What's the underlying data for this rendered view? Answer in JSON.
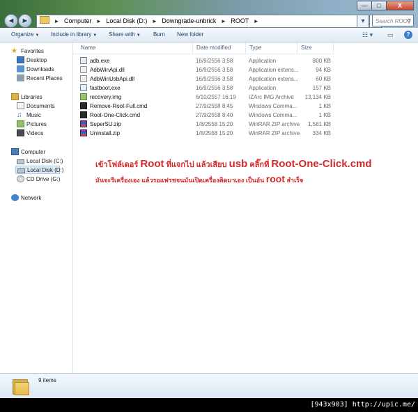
{
  "window": {
    "buttons": {
      "minimize": "—",
      "maximize": "□",
      "close": "X"
    }
  },
  "nav": {
    "back": "◄",
    "forward": "►",
    "breadcrumb": [
      "Computer",
      "Local Disk (D:)",
      "Downgrade-unbrick",
      "ROOT"
    ],
    "search_placeholder": "Search ROOT"
  },
  "toolbar": {
    "organize": "Organize",
    "include_in_library": "Include in library",
    "share_with": "Share with",
    "burn": "Burn",
    "new_folder": "New folder"
  },
  "sidebar": {
    "favorites_header": "Favorites",
    "favorites": [
      {
        "label": "Desktop",
        "icon": "desktop-icon"
      },
      {
        "label": "Downloads",
        "icon": "downloads-icon"
      },
      {
        "label": "Recent Places",
        "icon": "recent-places-icon"
      }
    ],
    "libraries_header": "Libraries",
    "libraries": [
      {
        "label": "Documents",
        "icon": "documents-icon"
      },
      {
        "label": "Music",
        "icon": "music-icon"
      },
      {
        "label": "Pictures",
        "icon": "pictures-icon"
      },
      {
        "label": "Videos",
        "icon": "videos-icon"
      }
    ],
    "computer_header": "Computer",
    "drives": [
      {
        "label": "Local Disk (C:)",
        "icon": "disk-icon"
      },
      {
        "label": "Local Disk (D:)",
        "icon": "disk-icon",
        "selected": true
      },
      {
        "label": "CD Drive (G:)",
        "icon": "cd-drive-icon"
      }
    ],
    "network_header": "Network"
  },
  "columns": {
    "name": "Name",
    "date": "Date modified",
    "type": "Type",
    "size": "Size"
  },
  "files": [
    {
      "name": "adb.exe",
      "date": "16/9/2556 3:58",
      "type": "Application",
      "size": "800 KB",
      "icon": "app"
    },
    {
      "name": "AdbWinApi.dll",
      "date": "16/9/2556 3:58",
      "type": "Application extens...",
      "size": "94 KB",
      "icon": "dll"
    },
    {
      "name": "AdbWinUsbApi.dll",
      "date": "16/9/2556 3:58",
      "type": "Application extens...",
      "size": "60 KB",
      "icon": "dll"
    },
    {
      "name": "fastboot.exe",
      "date": "16/9/2556 3:58",
      "type": "Application",
      "size": "157 KB",
      "icon": "app"
    },
    {
      "name": "recovery.img",
      "date": "6/10/2557 16:19",
      "type": "IZArc IMG Archive",
      "size": "13,134 KB",
      "icon": "img"
    },
    {
      "name": "Remove-Root-Full.cmd",
      "date": "27/9/2558 8:45",
      "type": "Windows Comma...",
      "size": "1 KB",
      "icon": "cmd"
    },
    {
      "name": "Root-One-Click.cmd",
      "date": "27/9/2558 8:40",
      "type": "Windows Comma...",
      "size": "1 KB",
      "icon": "cmd"
    },
    {
      "name": "SuperSU.zip",
      "date": "1/8/2558 15:20",
      "type": "WinRAR ZIP archive",
      "size": "1,561 KB",
      "icon": "zip"
    },
    {
      "name": "Uninstall.zip",
      "date": "1/8/2558 15:20",
      "type": "WinRAR ZIP archive",
      "size": "334 KB",
      "icon": "zip"
    }
  ],
  "annotation": {
    "line1_a": "เข้าโฟล์เดอร์ ",
    "line1_b": "Root",
    "line1_c": " ที่แจกไป แล้วเสียบ ",
    "line1_d": "usb",
    "line1_e": " คลิ๊กที่ ",
    "line1_f": "Root-One-Click.cmd",
    "line2_a": "มันจะรีเครื่องเอง แล้วรอแฟรชจนมันเปิดเครื่องติดมาเอง เป็นอัน ",
    "line2_b": "root",
    "line2_c": " สำเร็จ",
    "color": "#d42a2a"
  },
  "details": {
    "item_count": "9 items"
  },
  "watermark": "[943x903] http://upic.me/"
}
